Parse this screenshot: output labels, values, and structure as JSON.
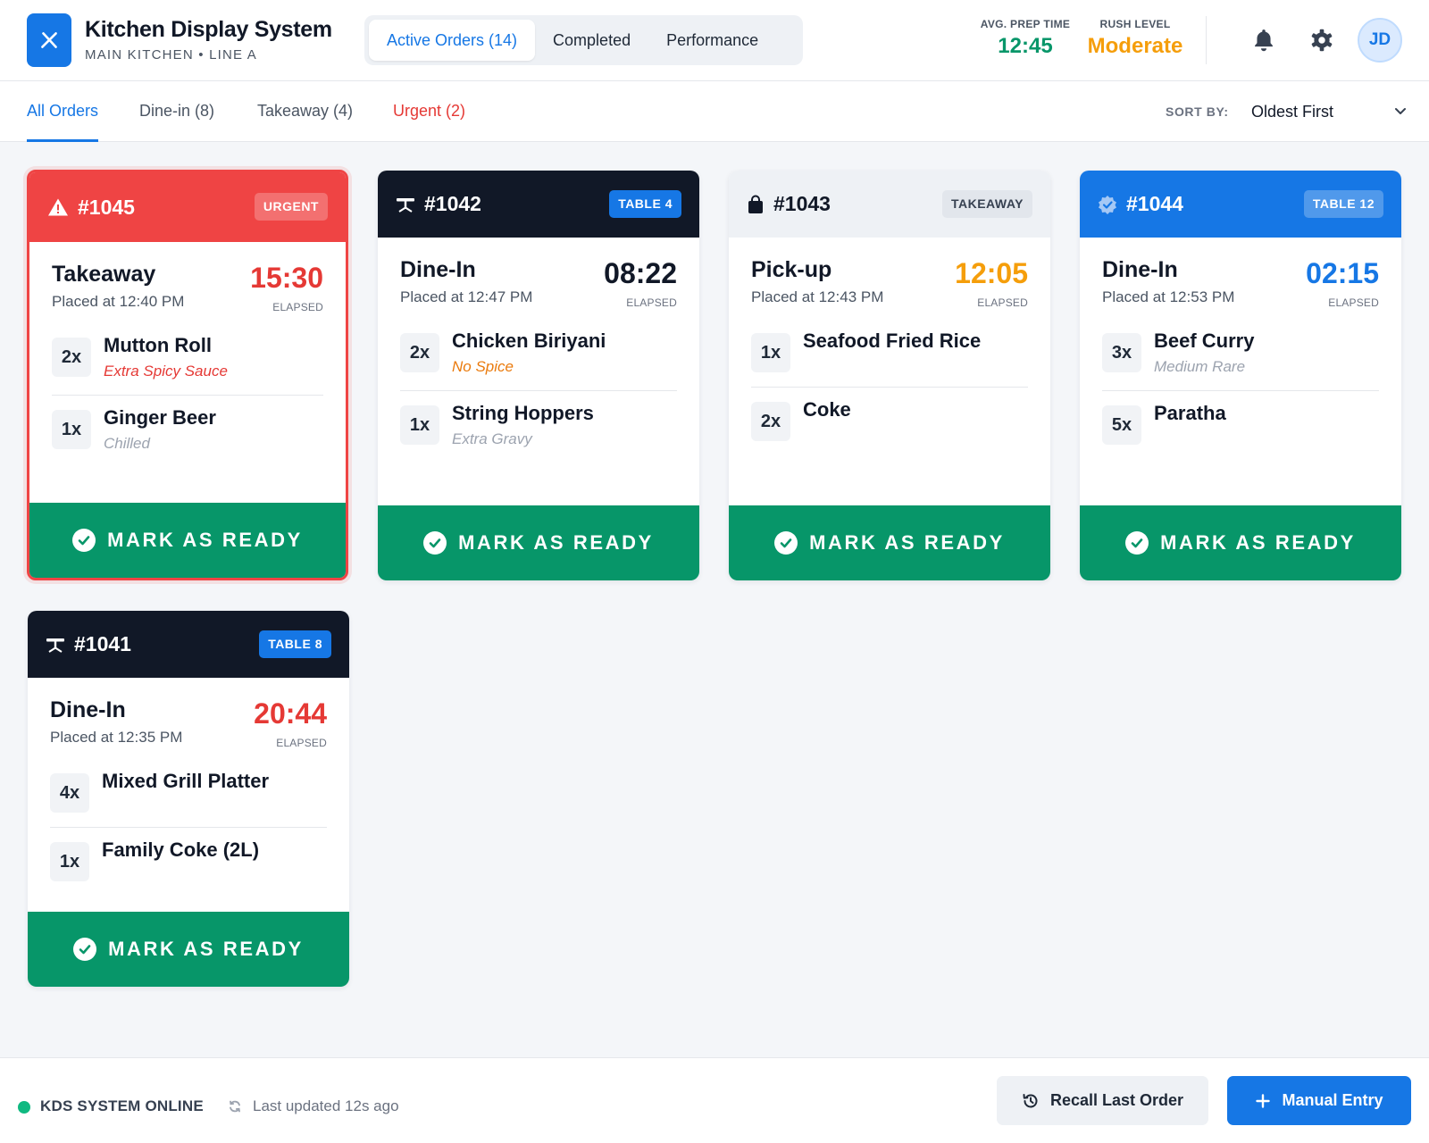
{
  "header": {
    "title": "Kitchen Display System",
    "subtitle": "MAIN KITCHEN • LINE A",
    "tabs": [
      {
        "label": "Active Orders (14)",
        "active": true
      },
      {
        "label": "Completed",
        "active": false
      },
      {
        "label": "Performance",
        "active": false
      }
    ],
    "avg_prep": {
      "label": "AVG. PREP TIME",
      "value": "12:45",
      "color": "#079669"
    },
    "rush": {
      "label": "RUSH LEVEL",
      "value": "Moderate",
      "color": "#f59e0b"
    },
    "avatar": "JD",
    "icons": [
      "bell-icon",
      "gear-icon"
    ]
  },
  "filters": {
    "tabs": [
      {
        "label": "All Orders",
        "active": true
      },
      {
        "label": "Dine-in (8)"
      },
      {
        "label": "Takeaway (4)"
      },
      {
        "label": "Urgent (2)",
        "urgent": true
      }
    ],
    "sort_label": "SORT BY:",
    "sort_value": "Oldest First"
  },
  "orders": [
    {
      "number": "#1045",
      "badge": "URGENT",
      "header_icon": "warning-icon",
      "type": "Takeaway",
      "placed": "Placed at 12:40 PM",
      "timer": "15:30",
      "timer_color": "#e53935",
      "elapsed": "ELAPSED",
      "items": [
        {
          "qty": "2x",
          "name": "Mutton Roll",
          "note": "Extra Spicy Sauce",
          "note_color": "#e53935"
        },
        {
          "qty": "1x",
          "name": "Ginger Beer",
          "note": "Chilled",
          "note_color": "#9ca3af"
        }
      ],
      "button": "MARK AS READY"
    },
    {
      "number": "#1042",
      "badge": "TABLE 4",
      "header_icon": "table-icon",
      "type": "Dine-In",
      "placed": "Placed at 12:47 PM",
      "timer": "08:22",
      "timer_color": "#111827",
      "elapsed": "ELAPSED",
      "items": [
        {
          "qty": "2x",
          "name": "Chicken Biriyani",
          "note": "No Spice",
          "note_color": "#ea7a0c"
        },
        {
          "qty": "1x",
          "name": "String Hoppers",
          "note": "Extra Gravy",
          "note_color": "#9ca3af"
        }
      ],
      "button": "MARK AS READY"
    },
    {
      "number": "#1043",
      "badge": "TAKEAWAY",
      "header_icon": "shopping-bag-icon",
      "type": "Pick-up",
      "placed": "Placed at 12:43 PM",
      "timer": "12:05",
      "timer_color": "#f59e0b",
      "elapsed": "ELAPSED",
      "items": [
        {
          "qty": "1x",
          "name": "Seafood Fried Rice",
          "note": ""
        },
        {
          "qty": "2x",
          "name": "Coke",
          "note": ""
        }
      ],
      "button": "MARK AS READY"
    },
    {
      "number": "#1044",
      "badge": "TABLE 12",
      "header_icon": "verified-badge-icon",
      "type": "Dine-In",
      "placed": "Placed at 12:53 PM",
      "timer": "02:15",
      "timer_color": "#1677e5",
      "elapsed": "ELAPSED",
      "items": [
        {
          "qty": "3x",
          "name": "Beef Curry",
          "note": "Medium Rare",
          "note_color": "#9ca3af"
        },
        {
          "qty": "5x",
          "name": "Paratha",
          "note": ""
        }
      ],
      "button": "MARK AS READY"
    },
    {
      "number": "#1041",
      "badge": "TABLE 8",
      "header_icon": "table-icon",
      "type": "Dine-In",
      "placed": "Placed at 12:35 PM",
      "timer": "20:44",
      "timer_color": "#e53935",
      "elapsed": "ELAPSED",
      "items": [
        {
          "qty": "4x",
          "name": "Mixed Grill Platter",
          "note": ""
        },
        {
          "qty": "1x",
          "name": "Family Coke (2L)",
          "note": ""
        }
      ],
      "button": "MARK AS READY"
    }
  ],
  "footer": {
    "status": "KDS SYSTEM ONLINE",
    "updated": "Last updated 12s ago",
    "recall": "Recall Last Order",
    "manual": "Manual Entry"
  }
}
